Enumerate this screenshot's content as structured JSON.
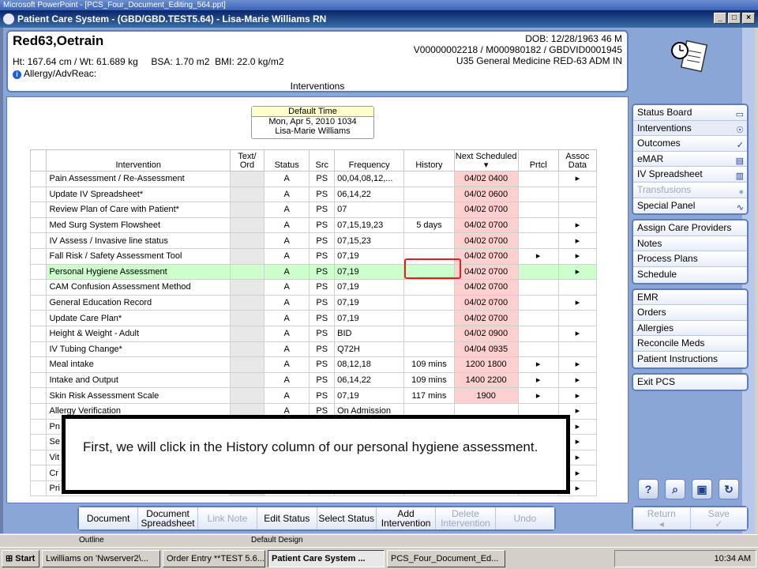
{
  "powerpoint": {
    "title": "Microsoft PowerPoint - [PCS_Four_Document_Editing_564.ppt]",
    "status_left": "Outline",
    "status_mid": "Default Design"
  },
  "window": {
    "title": "Patient Care System - (GBD/GBD.TEST5.64) - Lisa-Marie Williams RN"
  },
  "patient": {
    "name": "Red63,Oetrain",
    "measurements": "Ht: 167.64 cm / Wt: 61.689 kg     BSA: 1.70 m2  BMI: 22.0 kg/m2",
    "allergy": "Allergy/AdvReac:",
    "dob": "DOB: 12/28/1963 46 M",
    "ids": "V00000002218 / M000980182 / GBDVID0001945",
    "unit": "U35 General Medicine  RED-63  ADM IN",
    "section": "Interventions"
  },
  "default_time": {
    "header": "Default Time",
    "date": "Mon, Apr 5, 2010  1034",
    "user": "Lisa-Marie Williams"
  },
  "table": {
    "headers": [
      "Intervention",
      "Text/ Ord",
      "Status",
      "Src",
      "Frequency",
      "History",
      "Next Scheduled",
      "Prtcl",
      "Assoc Data"
    ],
    "rows": [
      {
        "name": "Pain Assessment / Re-Assessment",
        "status": "A",
        "src": "PS",
        "freq": "00,04,08,12,...",
        "history": "",
        "next": "04/02 0400",
        "prtcl": "",
        "assoc": "▸"
      },
      {
        "name": "Update IV Spreadsheet*",
        "status": "A",
        "src": "PS",
        "freq": "06,14,22",
        "history": "",
        "next": "04/02 0600",
        "prtcl": "",
        "assoc": ""
      },
      {
        "name": "Review Plan of Care with Patient*",
        "status": "A",
        "src": "PS",
        "freq": "07",
        "history": "",
        "next": "04/02 0700",
        "prtcl": "",
        "assoc": ""
      },
      {
        "name": "Med Surg System Flowsheet",
        "status": "A",
        "src": "PS",
        "freq": "07,15,19,23",
        "history": "5 days",
        "next": "04/02 0700",
        "prtcl": "",
        "assoc": "▸"
      },
      {
        "name": "IV Assess / Invasive line status",
        "status": "A",
        "src": "PS",
        "freq": "07,15,23",
        "history": "",
        "next": "04/02 0700",
        "prtcl": "",
        "assoc": "▸"
      },
      {
        "name": "Fall Risk / Safety Assessment Tool",
        "status": "A",
        "src": "PS",
        "freq": "07,19",
        "history": "",
        "next": "04/02 0700",
        "prtcl": "▸",
        "assoc": "▸"
      },
      {
        "name": "Personal Hygiene Assessment",
        "status": "A",
        "src": "PS",
        "freq": "07,19",
        "history": "",
        "next": "04/02 0700",
        "prtcl": "",
        "assoc": "▸"
      },
      {
        "name": "CAM Confusion Assessment Method",
        "status": "A",
        "src": "PS",
        "freq": "07,19",
        "history": "",
        "next": "04/02 0700",
        "prtcl": "",
        "assoc": ""
      },
      {
        "name": "General Education Record",
        "status": "A",
        "src": "PS",
        "freq": "07,19",
        "history": "",
        "next": "04/02 0700",
        "prtcl": "",
        "assoc": "▸"
      },
      {
        "name": "Update Care Plan*",
        "status": "A",
        "src": "PS",
        "freq": "07,19",
        "history": "",
        "next": "04/02 0700",
        "prtcl": "",
        "assoc": ""
      },
      {
        "name": "Height & Weight - Adult",
        "status": "A",
        "src": "PS",
        "freq": "BID",
        "history": "",
        "next": "04/02 0900",
        "prtcl": "",
        "assoc": "▸"
      },
      {
        "name": "IV Tubing Change*",
        "status": "A",
        "src": "PS",
        "freq": "Q72H",
        "history": "",
        "next": "04/04 0935",
        "prtcl": "",
        "assoc": ""
      },
      {
        "name": "Meal intake",
        "status": "A",
        "src": "PS",
        "freq": "08,12,18",
        "history": "109 mins",
        "next": "1200 1800",
        "prtcl": "▸",
        "assoc": "▸"
      },
      {
        "name": "Intake and Output",
        "status": "A",
        "src": "PS",
        "freq": "06,14,22",
        "history": "109 mins",
        "next": "1400 2200",
        "prtcl": "▸",
        "assoc": "▸"
      },
      {
        "name": "Skin Risk Assessment Scale",
        "status": "A",
        "src": "PS",
        "freq": "07,19",
        "history": "117 mins",
        "next": "1900",
        "prtcl": "▸",
        "assoc": "▸"
      },
      {
        "name": "Allergy Verification",
        "status": "A",
        "src": "PS",
        "freq": "On Admission",
        "history": "",
        "next": "",
        "prtcl": "",
        "assoc": "▸"
      },
      {
        "name": "Pn",
        "status": "",
        "src": "",
        "freq": "",
        "history": "",
        "next": "",
        "prtcl": "",
        "assoc": "▸"
      },
      {
        "name": "Se",
        "status": "",
        "src": "",
        "freq": "",
        "history": "",
        "next": "",
        "prtcl": "",
        "assoc": "▸"
      },
      {
        "name": "Vit",
        "status": "",
        "src": "",
        "freq": "",
        "history": "",
        "next": "",
        "prtcl": "",
        "assoc": "▸"
      },
      {
        "name": "Cr",
        "status": "",
        "src": "",
        "freq": "",
        "history": "",
        "next": "",
        "prtcl": "",
        "assoc": "▸"
      },
      {
        "name": "Pri",
        "status": "",
        "src": "",
        "freq": "",
        "history": "",
        "next": "",
        "prtcl": "",
        "assoc": "▸"
      }
    ]
  },
  "callout": {
    "text": "First, we will click in the History column of our personal hygiene assessment."
  },
  "sidebar": {
    "group1": [
      {
        "label": "Status Board",
        "icon": "board-icon"
      },
      {
        "label": "Interventions",
        "icon": "interventions-icon"
      },
      {
        "label": "Outcomes",
        "icon": "checklist-icon"
      },
      {
        "label": "eMAR",
        "icon": "emar-icon"
      },
      {
        "label": "IV Spreadsheet",
        "icon": "iv-icon"
      },
      {
        "label": "Transfusions",
        "icon": "blood-drop-icon"
      },
      {
        "label": "Special Panel",
        "icon": "pulse-icon"
      }
    ],
    "group2": [
      {
        "label": "Assign Care Providers"
      },
      {
        "label": "Notes"
      },
      {
        "label": "Process Plans"
      },
      {
        "label": "Schedule"
      }
    ],
    "group3": [
      {
        "label": "EMR"
      },
      {
        "label": "Orders"
      },
      {
        "label": "Allergies"
      },
      {
        "label": "Reconcile Meds"
      },
      {
        "label": "Patient Instructions"
      }
    ],
    "group4": [
      {
        "label": "Exit PCS"
      }
    ]
  },
  "bottom_buttons": [
    {
      "label": "Document",
      "enabled": true
    },
    {
      "label": "Document Spreadsheet",
      "enabled": true
    },
    {
      "label": "Link Note",
      "enabled": false
    },
    {
      "label": "Edit Status",
      "enabled": true
    },
    {
      "label": "Select Status",
      "enabled": true
    },
    {
      "label": "Add Intervention",
      "enabled": true
    },
    {
      "label": "Delete Intervention",
      "enabled": false
    },
    {
      "label": "Undo",
      "enabled": false
    }
  ],
  "return_save": {
    "return": "Return",
    "save": "Save"
  },
  "taskbar": {
    "start": "Start",
    "items": [
      "Lwilliams on 'Nwserver2\\...",
      "Order Entry **TEST 5.6...",
      "Patient Care System ...",
      "PCS_Four_Document_Ed..."
    ],
    "clock": "10:34 AM"
  }
}
